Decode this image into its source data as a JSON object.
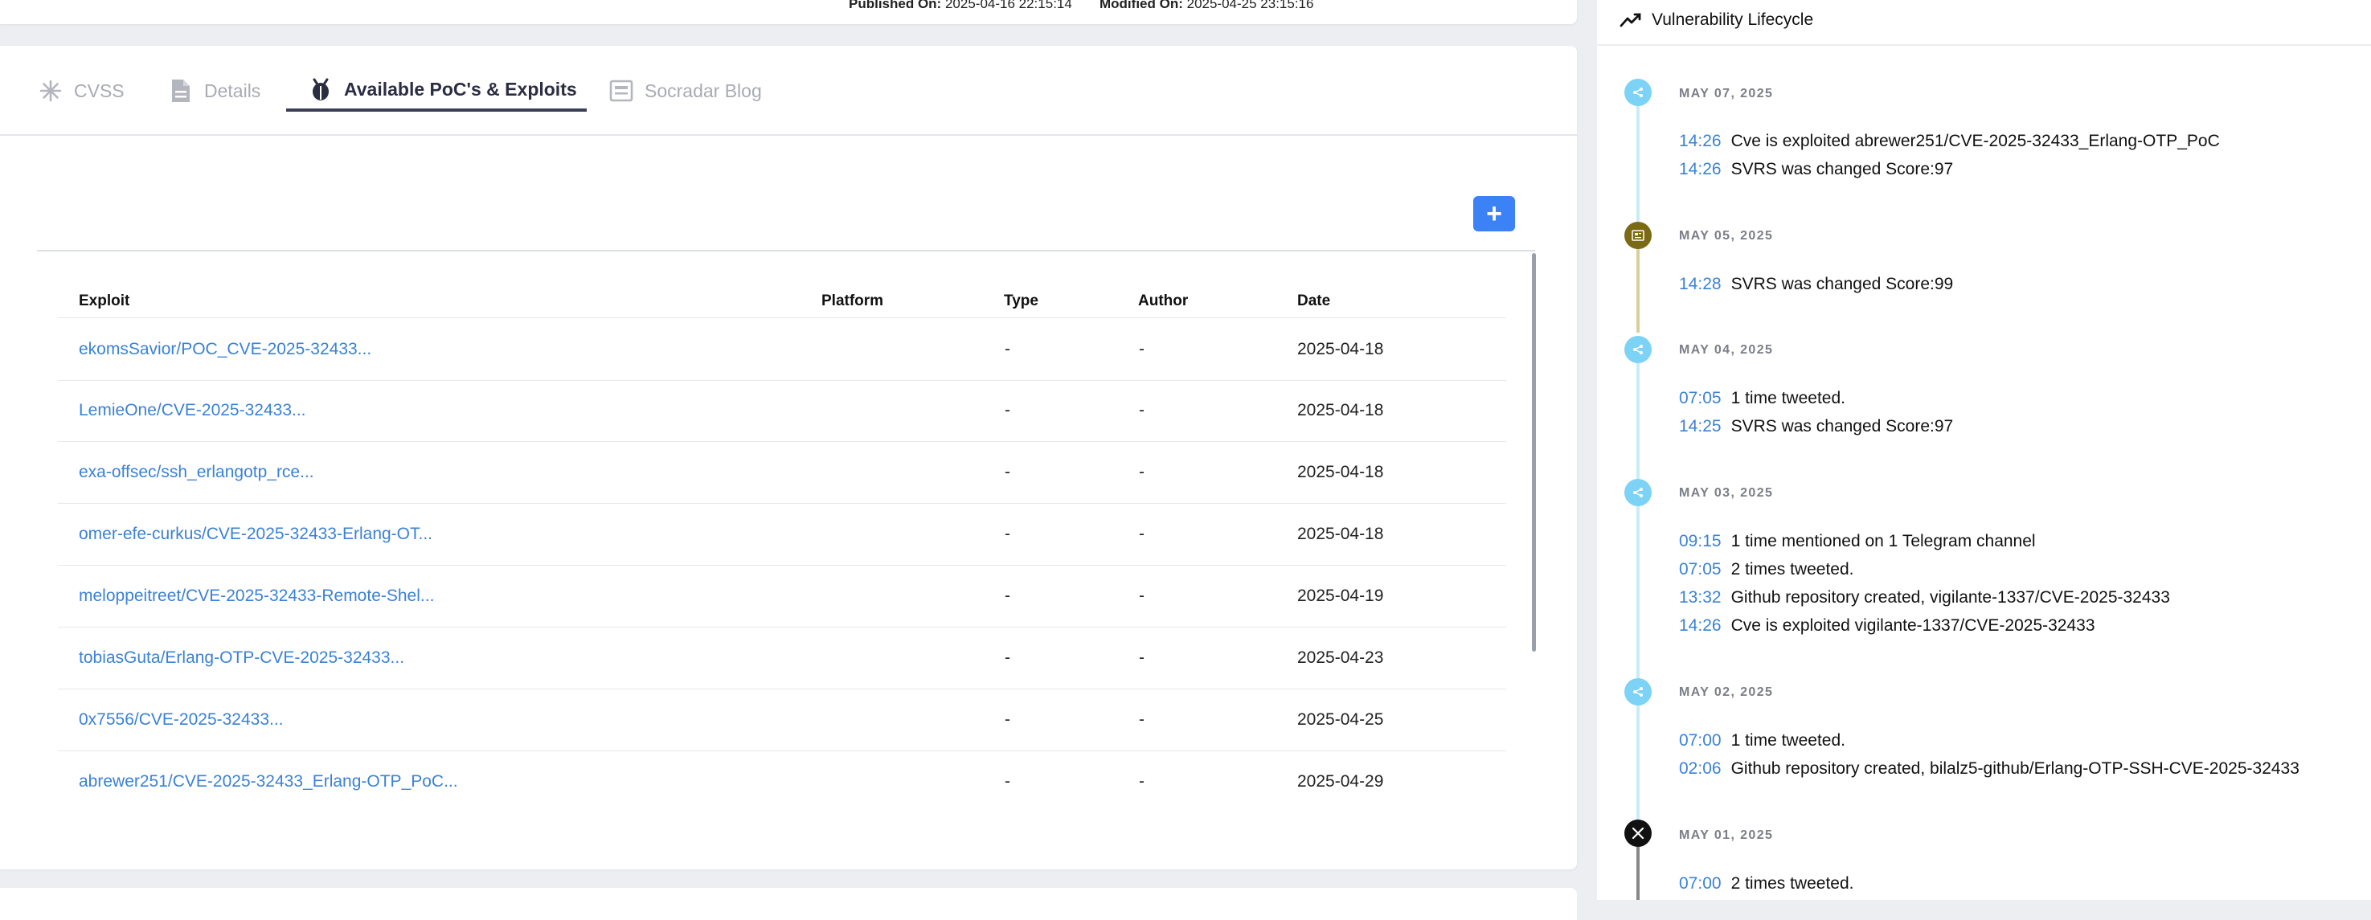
{
  "meta": {
    "published_label": "Published On:",
    "published_value": "2025-04-16 22:15:14",
    "modified_label": "Modified On:",
    "modified_value": "2025-04-25 23:15:16"
  },
  "tabs": [
    {
      "label": "CVSS",
      "icon": "asterisk-icon",
      "active": false
    },
    {
      "label": "Details",
      "icon": "document-icon",
      "active": false
    },
    {
      "label": "Available PoC's & Exploits",
      "icon": "bug-icon",
      "active": true
    },
    {
      "label": "Socradar Blog",
      "icon": "blog-icon",
      "active": false
    }
  ],
  "add_button": {
    "label": "+",
    "color": "#3b82f6"
  },
  "table": {
    "headers": [
      "Exploit",
      "Platform",
      "Type",
      "Author",
      "Date"
    ],
    "rows": [
      {
        "exploit": "ekomsSavior/POC_CVE-2025-32433...",
        "platform": "",
        "type": "-",
        "author": "-",
        "date": "2025-04-18"
      },
      {
        "exploit": "LemieOne/CVE-2025-32433...",
        "platform": "",
        "type": "-",
        "author": "-",
        "date": "2025-04-18"
      },
      {
        "exploit": "exa-offsec/ssh_erlangotp_rce...",
        "platform": "",
        "type": "-",
        "author": "-",
        "date": "2025-04-18"
      },
      {
        "exploit": "omer-efe-curkus/CVE-2025-32433-Erlang-OT...",
        "platform": "",
        "type": "-",
        "author": "-",
        "date": "2025-04-18"
      },
      {
        "exploit": "meloppeitreet/CVE-2025-32433-Remote-Shel...",
        "platform": "",
        "type": "-",
        "author": "-",
        "date": "2025-04-19"
      },
      {
        "exploit": "tobiasGuta/Erlang-OTP-CVE-2025-32433...",
        "platform": "",
        "type": "-",
        "author": "-",
        "date": "2025-04-23"
      },
      {
        "exploit": "0x7556/CVE-2025-32433...",
        "platform": "",
        "type": "-",
        "author": "-",
        "date": "2025-04-25"
      },
      {
        "exploit": "abrewer251/CVE-2025-32433_Erlang-OTP_PoC...",
        "platform": "",
        "type": "-",
        "author": "-",
        "date": "2025-04-29"
      }
    ]
  },
  "lifecycle": {
    "title": "Vulnerability Lifecycle",
    "icon": "trending-icon",
    "groups": [
      {
        "date": "MAY 07, 2025",
        "icon": "node-icon",
        "color": "#7dd3f5",
        "events": [
          {
            "time": "14:26",
            "text": "Cve is exploited abrewer251/CVE-2025-32433_Erlang-OTP_PoC"
          },
          {
            "time": "14:26",
            "text": "SVRS was changed Score:97"
          }
        ]
      },
      {
        "date": "MAY 05, 2025",
        "icon": "newspaper-icon",
        "color": "#7b6a14",
        "events": [
          {
            "time": "14:28",
            "text": "SVRS was changed Score:99"
          }
        ]
      },
      {
        "date": "MAY 04, 2025",
        "icon": "node-icon",
        "color": "#7dd3f5",
        "events": [
          {
            "time": "07:05",
            "text": "1 time tweeted."
          },
          {
            "time": "14:25",
            "text": "SVRS was changed Score:97"
          }
        ]
      },
      {
        "date": "MAY 03, 2025",
        "icon": "node-icon",
        "color": "#7dd3f5",
        "events": [
          {
            "time": "09:15",
            "text": "1 time mentioned on 1 Telegram channel"
          },
          {
            "time": "07:05",
            "text": "2 times tweeted."
          },
          {
            "time": "13:32",
            "text": "Github repository created, vigilante-1337/CVE-2025-32433"
          },
          {
            "time": "14:26",
            "text": "Cve is exploited vigilante-1337/CVE-2025-32433"
          }
        ]
      },
      {
        "date": "MAY 02, 2025",
        "icon": "node-icon",
        "color": "#7dd3f5",
        "events": [
          {
            "time": "07:00",
            "text": "1 time tweeted."
          },
          {
            "time": "02:06",
            "text": "Github repository created, bilalz5-github/Erlang-OTP-SSH-CVE-2025-32433"
          }
        ]
      },
      {
        "date": "MAY 01, 2025",
        "icon": "x-logo-icon",
        "color": "#111111",
        "events": [
          {
            "time": "07:00",
            "text": "2 times tweeted."
          }
        ]
      }
    ]
  }
}
